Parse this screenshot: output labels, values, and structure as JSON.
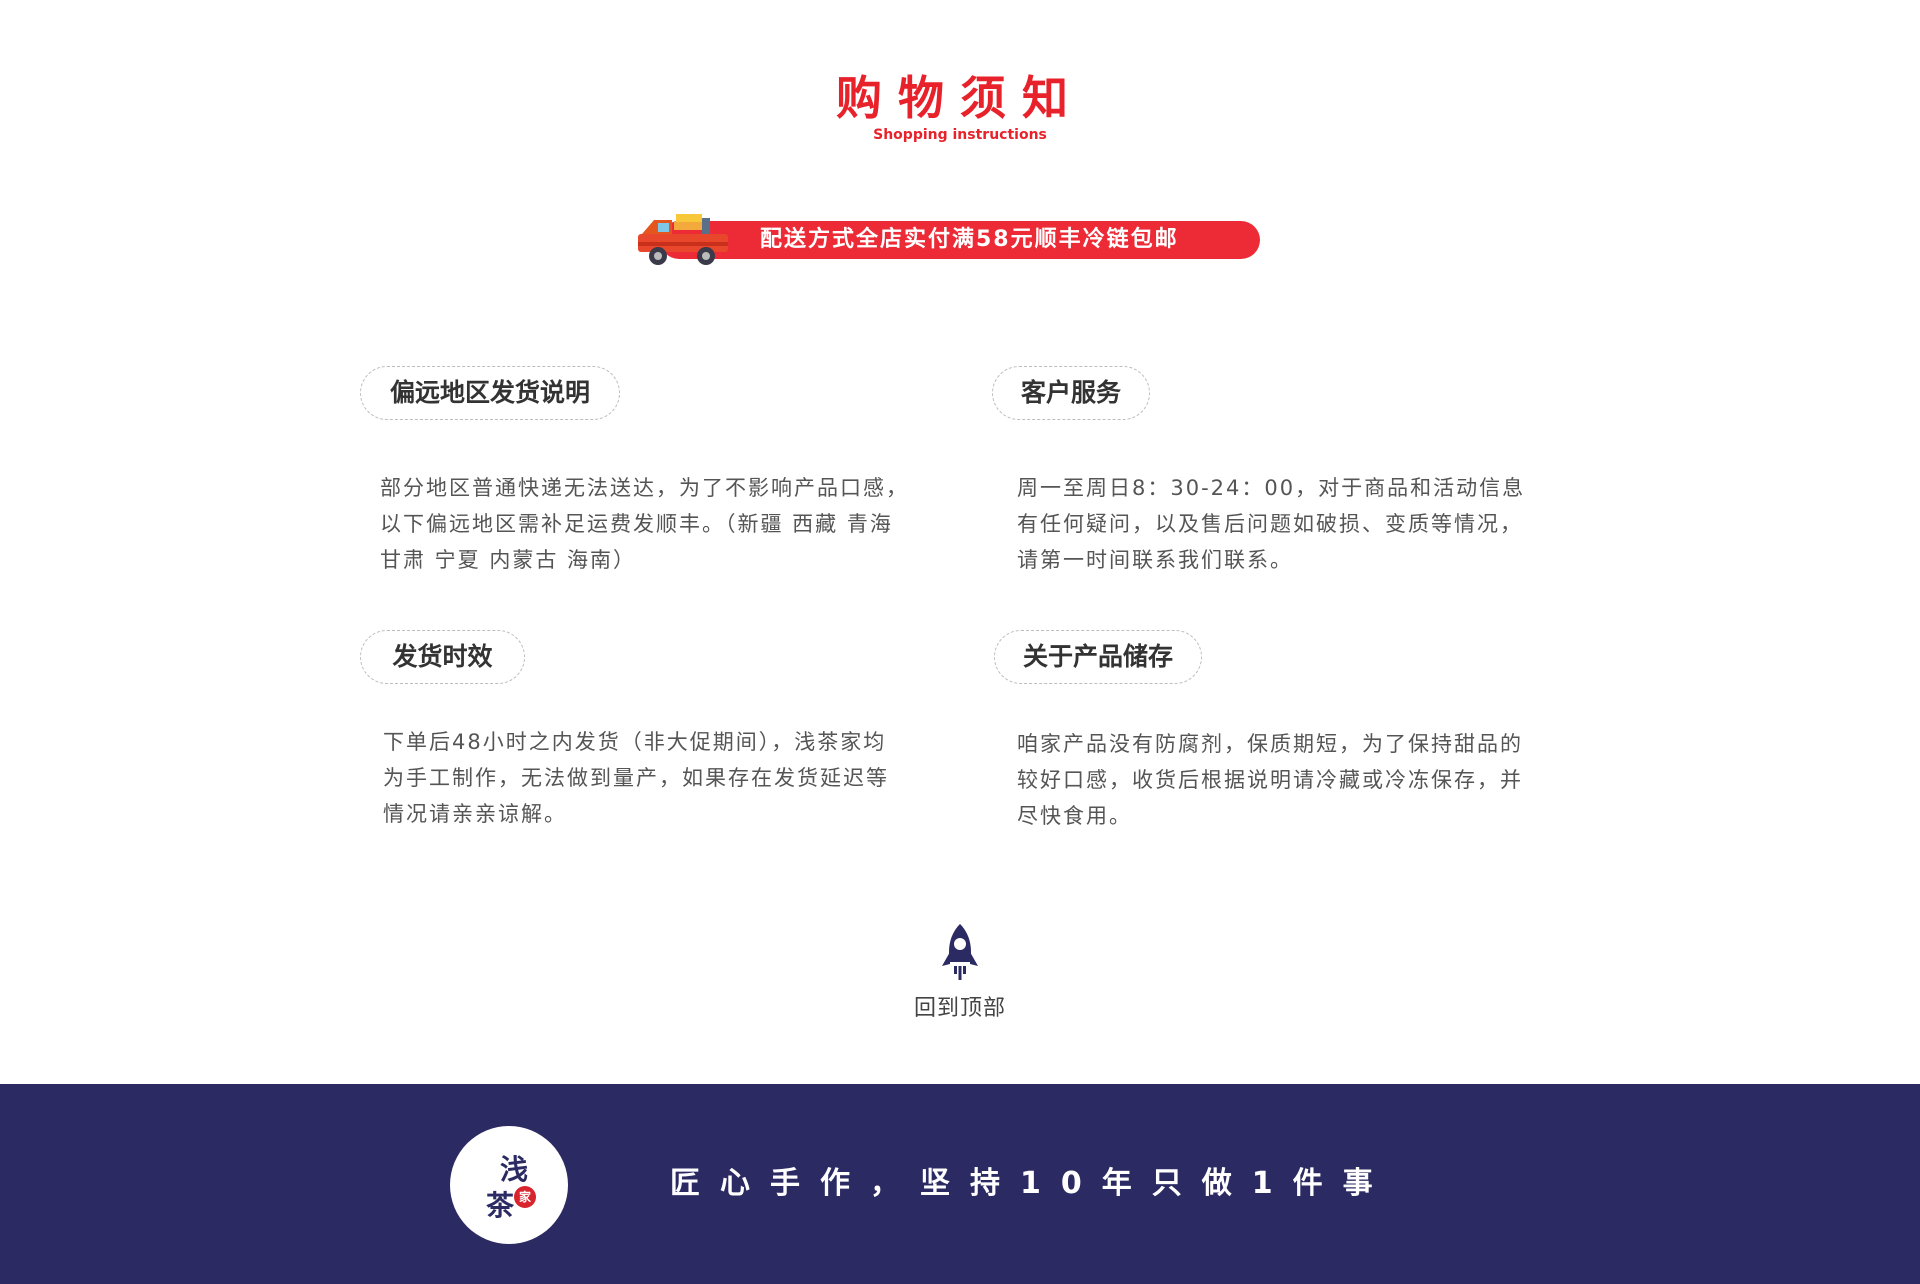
{
  "header": {
    "title": "购物须知",
    "subtitle": "Shopping instructions"
  },
  "banner": {
    "text": "配送方式全店实付满58元顺丰冷链包邮"
  },
  "sections": [
    {
      "title": "偏远地区发货说明",
      "lines": [
        "部分地区普通快递无法送达，为了不影响产品口感，",
        "以下偏远地区需补足运费发顺丰。（新疆 西藏 青海",
        "甘肃 宁夏 内蒙古 海南）"
      ]
    },
    {
      "title": "客户服务",
      "lines": [
        "周一至周日8：30-24：00，对于商品和活动信息",
        "有任何疑问，以及售后问题如破损、变质等情况，",
        "请第一时间联系我们联系。"
      ]
    },
    {
      "title": "发货时效",
      "lines": [
        "下单后48小时之内发货（非大促期间），浅茶家均",
        "为手工制作，无法做到量产，如果存在发货延迟等",
        "情况请亲亲谅解。"
      ]
    },
    {
      "title": "关于产品储存",
      "lines": [
        "咱家产品没有防腐剂，保质期短，为了保持甜品的",
        "较好口感，收货后根据说明请冷藏或冷冻保存，并",
        "尽快食用。"
      ]
    }
  ],
  "back_to_top": {
    "label": "回到顶部",
    "icon": "rocket-icon"
  },
  "footer": {
    "logo_char1": "浅",
    "logo_char2": "茶",
    "logo_badge": "家",
    "slogan": "匠心手作，坚持10年只做1件事"
  },
  "colors": {
    "accent_red": "#e8222b",
    "footer_navy": "#2b2a63"
  }
}
